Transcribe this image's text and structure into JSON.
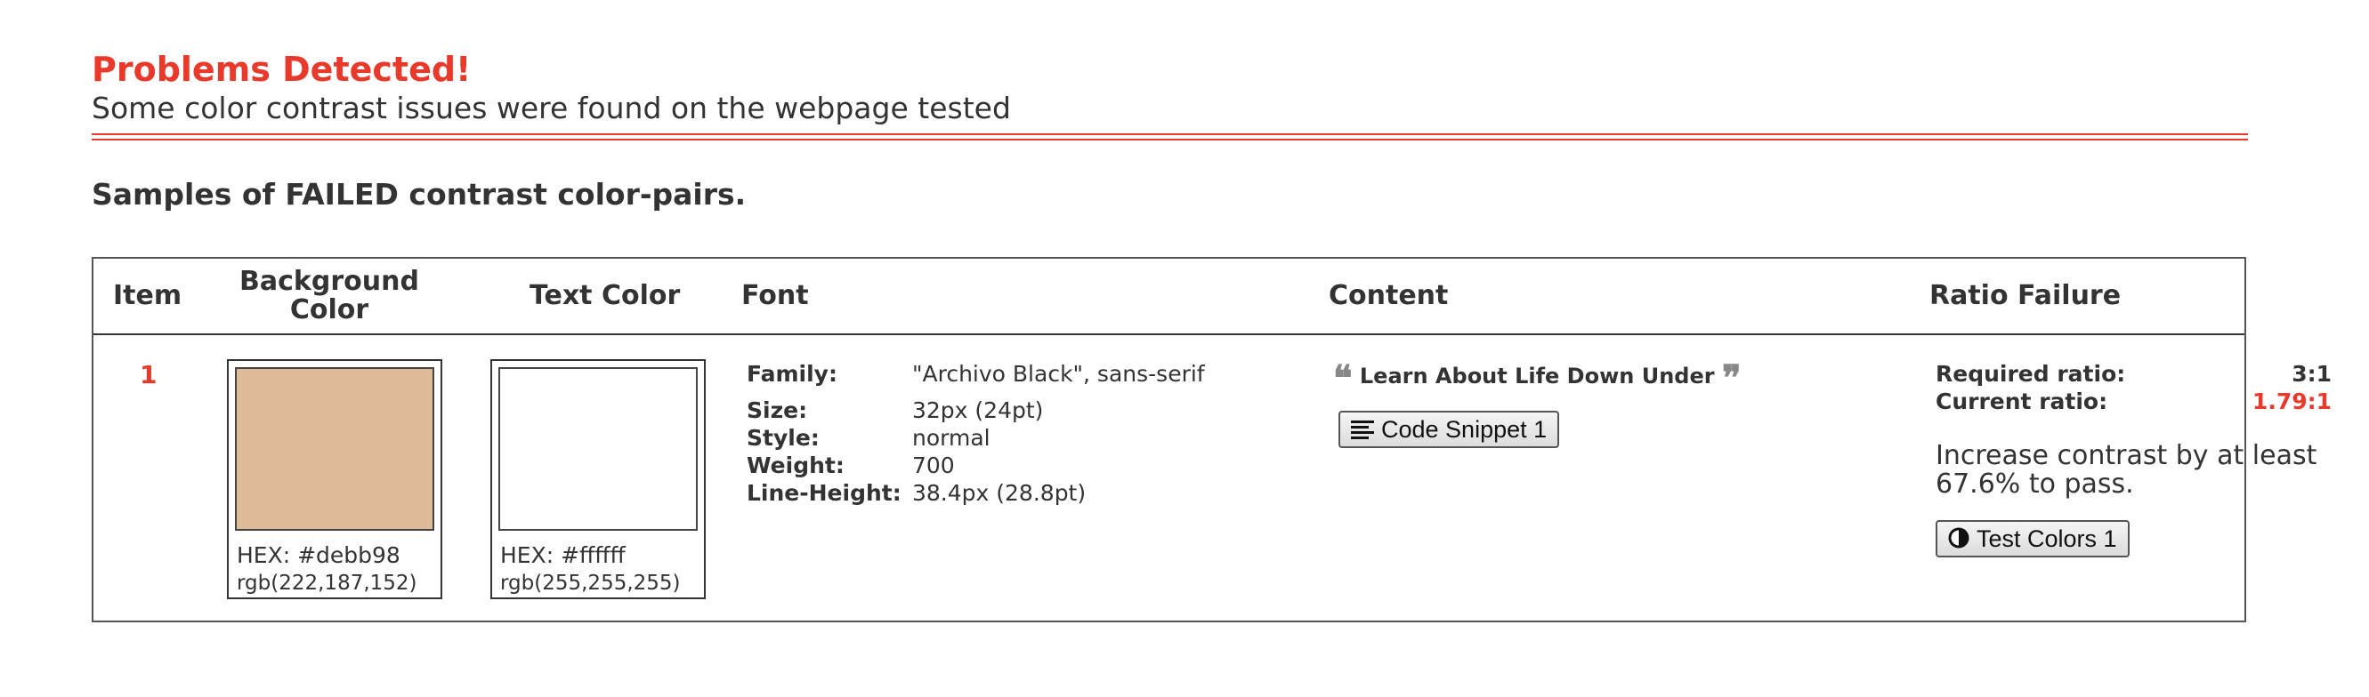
{
  "header": {
    "title": "Problems Detected!",
    "subtitle": "Some color contrast issues were found on the webpage tested"
  },
  "section_heading": "Samples of FAILED contrast color-pairs.",
  "table": {
    "columns": {
      "item": "Item",
      "background_color": "Background Color",
      "text_color": "Text Color",
      "font": "Font",
      "content": "Content",
      "ratio_failure": "Ratio Failure"
    },
    "rows": [
      {
        "item": "1",
        "background": {
          "color": "#debb98",
          "hex_label": "HEX: #debb98",
          "rgb_label": "rgb(222,187,152)"
        },
        "text": {
          "color": "#ffffff",
          "hex_label": "HEX: #ffffff",
          "rgb_label": "rgb(255,255,255)"
        },
        "font": {
          "family_label": "Family:",
          "family": "\"Archivo Black\", sans-serif",
          "size_label": "Size:",
          "size": "32px (24pt)",
          "style_label": "Style:",
          "style": "normal",
          "weight_label": "Weight:",
          "weight": "700",
          "line_height_label": "Line-Height:",
          "line_height": "38.4px (28.8pt)"
        },
        "content": {
          "quote_open_icon": "quote-open-icon",
          "text": "Learn About Life Down Under",
          "quote_close_icon": "quote-close-icon",
          "snippet_button": "Code Snippet 1",
          "snippet_icon": "align-left-icon"
        },
        "ratio": {
          "required_label": "Required ratio:",
          "required_value": "3:1",
          "current_label": "Current ratio:",
          "current_value": "1.79:1",
          "advice": "Increase contrast by at least 67.6% to pass.",
          "test_button": "Test Colors 1",
          "test_icon": "contrast-icon"
        }
      }
    ]
  },
  "colors": {
    "accent_red": "#e8392b",
    "text": "#333333"
  }
}
